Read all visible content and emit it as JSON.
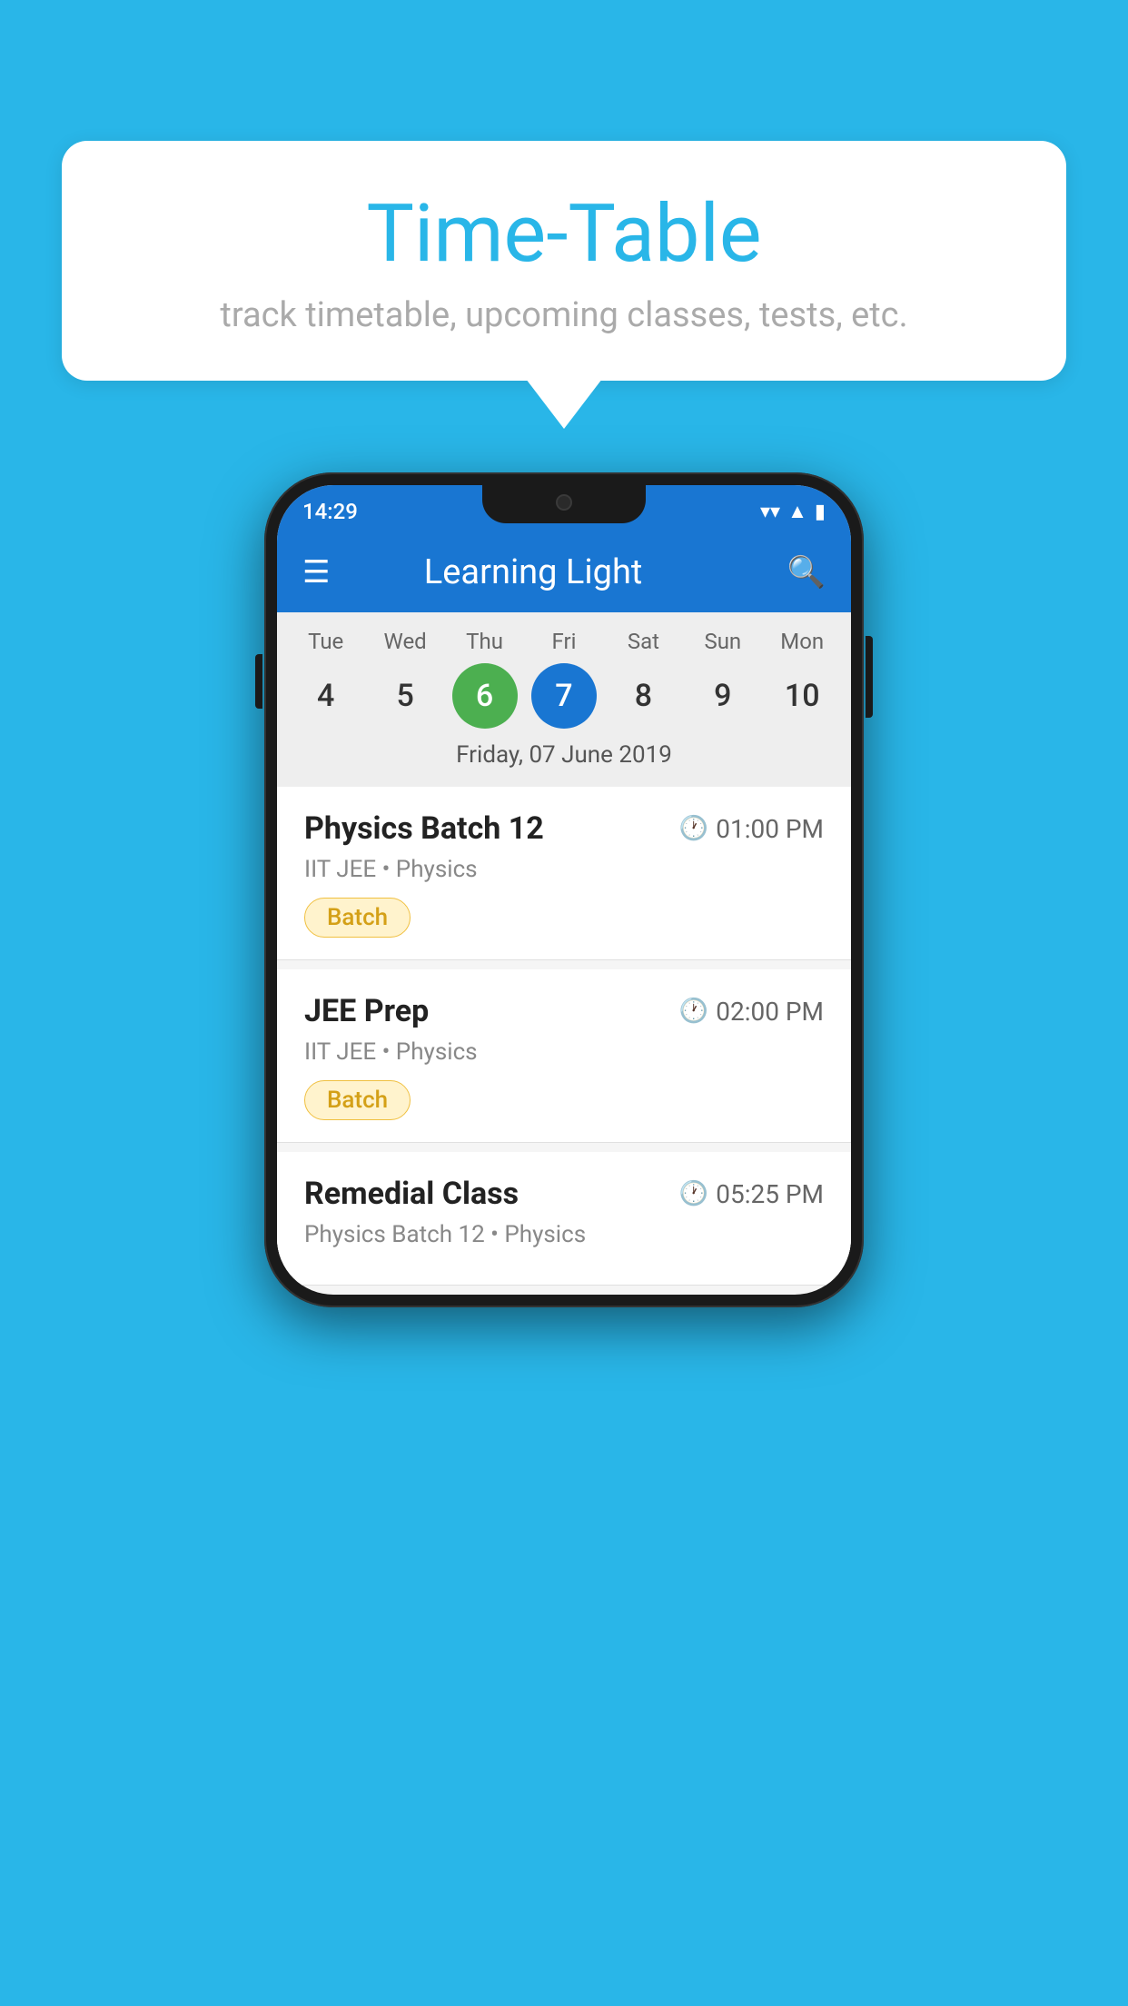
{
  "background_color": "#29b6e8",
  "speech_bubble": {
    "title": "Time-Table",
    "subtitle": "track timetable, upcoming classes, tests, etc."
  },
  "phone": {
    "status_bar": {
      "time": "14:29"
    },
    "app_bar": {
      "title": "Learning Light"
    },
    "calendar": {
      "days": [
        {
          "label": "Tue",
          "number": "4"
        },
        {
          "label": "Wed",
          "number": "5"
        },
        {
          "label": "Thu",
          "number": "6",
          "state": "today"
        },
        {
          "label": "Fri",
          "number": "7",
          "state": "selected"
        },
        {
          "label": "Sat",
          "number": "8"
        },
        {
          "label": "Sun",
          "number": "9"
        },
        {
          "label": "Mon",
          "number": "10"
        }
      ],
      "selected_date_label": "Friday, 07 June 2019"
    },
    "schedule": [
      {
        "title": "Physics Batch 12",
        "time": "01:00 PM",
        "subtitle": "IIT JEE • Physics",
        "badge": "Batch"
      },
      {
        "title": "JEE Prep",
        "time": "02:00 PM",
        "subtitle": "IIT JEE • Physics",
        "badge": "Batch"
      },
      {
        "title": "Remedial Class",
        "time": "05:25 PM",
        "subtitle": "Physics Batch 12 • Physics",
        "badge": null
      }
    ]
  }
}
